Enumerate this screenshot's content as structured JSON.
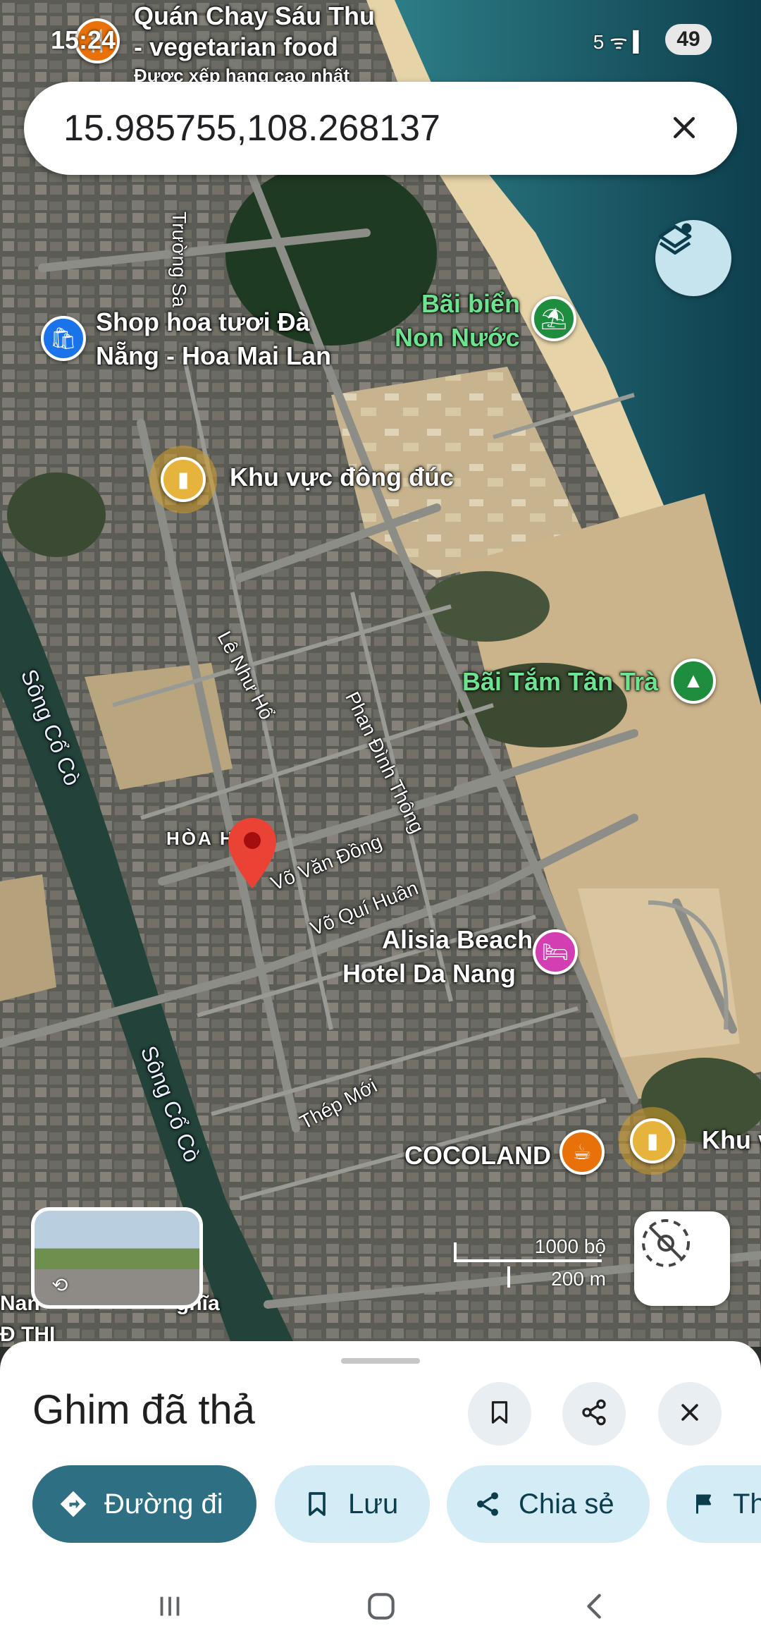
{
  "status_bar": {
    "time": "15:24",
    "battery": "49",
    "signal": "5 ᯤ ▍"
  },
  "search": {
    "query": "15.985755,108.268137"
  },
  "map": {
    "labels": {
      "quan_chay": "Quán Chay Sáu Thu",
      "quan_chay_2": "- vegetarian food",
      "quan_chay_3": "Được xếp hạng cao nhất",
      "truong_sa": "Trường Sa",
      "shop_hoa_1": "Shop hoa tươi Đà",
      "shop_hoa_2": "Nẵng - Hoa Mai Lan",
      "bai_bien_1": "Bãi biển",
      "bai_bien_2": "Non Nước",
      "khu_vuc": "Khu vực đông đúc",
      "le_nhu_ho": "Lê Như Hổ",
      "phan_dinh_thong": "Phan Đình Thông",
      "bai_tam": "Bãi Tắm Tân Trà",
      "song_co_co_1": "Sông Cổ Cò",
      "song_co_co_2": "Sông Cổ Cò",
      "hoa_hai": "HÒA H",
      "vo_van_dong": "Võ Văn Đồng",
      "vo_qui_huan": "Võ Quí Huân",
      "alisia_1": "Alisia Beach",
      "alisia_2": "Hotel Da Nang",
      "thep_moi": "Thép Mới",
      "cocoland": "COCOLAND",
      "khu_vu": "Khu vu",
      "nam_left": "Nan",
      "nghia": "ghĩa",
      "d_thi": "Đ THI"
    },
    "scale": {
      "imperial": "1000 bộ",
      "metric": "200 m"
    }
  },
  "sheet": {
    "title": "Ghim đã thả",
    "chips": {
      "directions": "Đường đi",
      "save": "Lưu",
      "share": "Chia sẻ",
      "report": "Th"
    }
  },
  "colors": {
    "primary_chip": "#2e6f83",
    "chip_bg": "#d3ecf6",
    "pin": "#ea4335",
    "layers_bg": "#c6e4ee"
  },
  "icons": {
    "close": "close-icon",
    "layers": "layers-icon",
    "bookmark": "bookmark-icon",
    "share": "share-icon",
    "directions": "directions-icon",
    "flag": "flag-icon",
    "compass": "compass-icon"
  }
}
